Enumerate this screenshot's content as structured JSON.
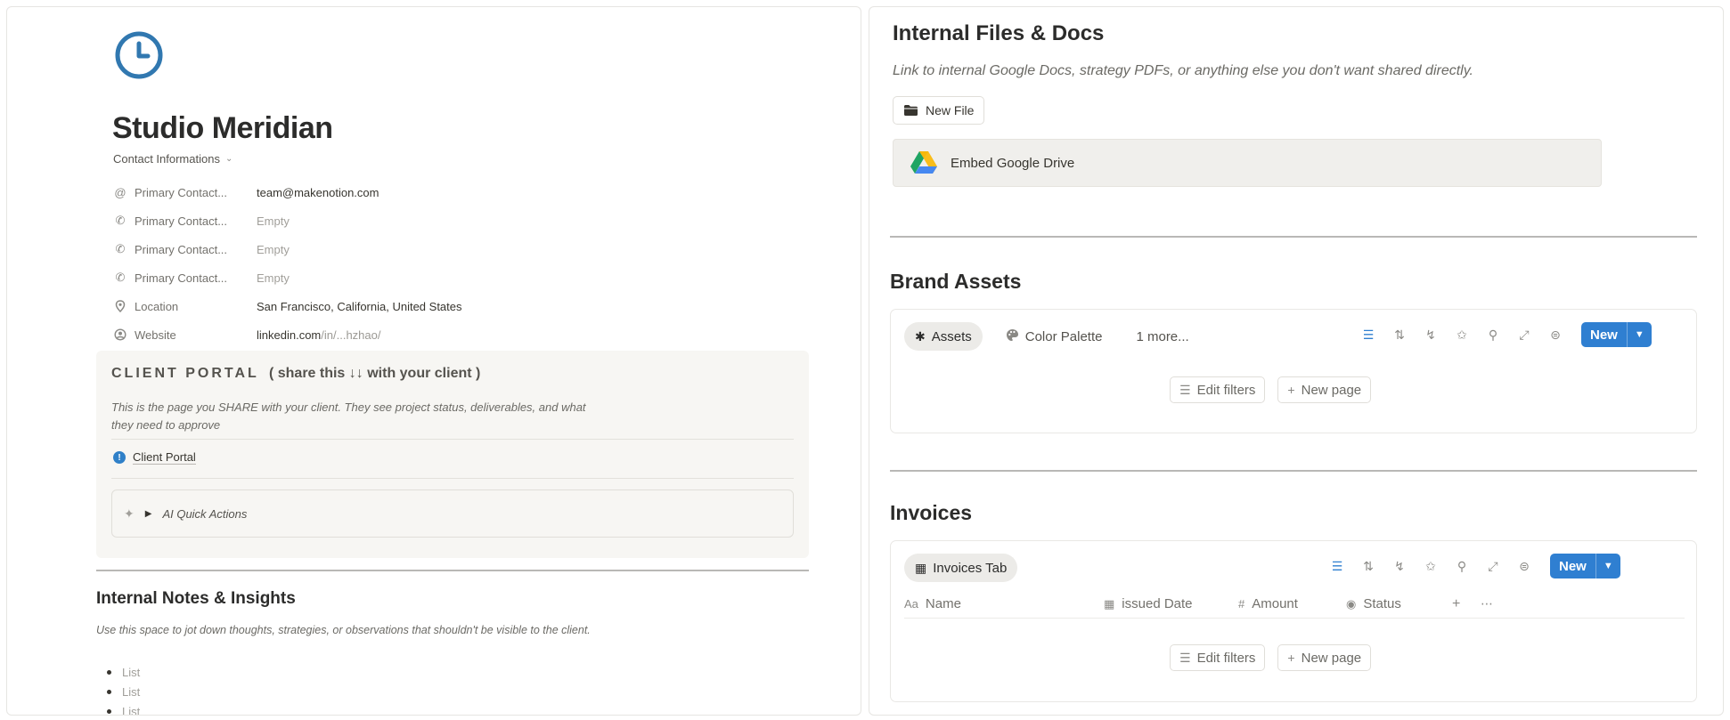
{
  "left": {
    "title": "Studio Meridian",
    "contact_section": {
      "label": "Contact Informations"
    },
    "properties": [
      {
        "icon": "at-icon",
        "name": "Primary Contact...",
        "value": "team@makenotion.com",
        "empty": false
      },
      {
        "icon": "phone-icon",
        "name": "Primary Contact...",
        "value": "Empty",
        "empty": true
      },
      {
        "icon": "phone-icon",
        "name": "Primary Contact...",
        "value": "Empty",
        "empty": true
      },
      {
        "icon": "phone-icon",
        "name": "Primary Contact...",
        "value": "Empty",
        "empty": true
      },
      {
        "icon": "location-pin-icon",
        "name": "Location",
        "value": "San Francisco, California, United States",
        "empty": false
      },
      {
        "icon": "website-icon",
        "name": "Website",
        "value_main": "linkedin.com",
        "value_muted": "/in/...hzhao/"
      }
    ],
    "portal": {
      "title": "CLIENT PORTAL",
      "title_suffix": "( share this ↓↓ with your client )",
      "description": "This is the page you SHARE with your client. They see project status, deliverables, and what they need to approve",
      "link_label": "Client Portal",
      "ai_toggle": "AI Quick Actions"
    },
    "notes": {
      "title": "Internal Notes & Insights",
      "description": "Use this space to jot down thoughts, strategies, or observations that shouldn't be visible to the client.",
      "items": [
        "List",
        "List",
        "List"
      ]
    }
  },
  "right": {
    "files": {
      "title": "Internal Files & Docs",
      "description": "Link to internal Google Docs, strategy PDFs, or anything else you don't want shared directly.",
      "new_file_label": "New File",
      "embed_label": "Embed Google Drive"
    },
    "brand": {
      "title": "Brand Assets",
      "tabs": [
        {
          "label": "Assets",
          "icon": "magic-wand-icon",
          "active": true
        },
        {
          "label": "Color Palette",
          "icon": "palette-icon",
          "active": false
        },
        {
          "label": "1 more...",
          "icon": "",
          "active": false
        }
      ],
      "new_label": "New",
      "edit_filters": "Edit filters",
      "new_page": "New page"
    },
    "invoices": {
      "title": "Invoices",
      "tab_label": "Invoices Tab",
      "columns": [
        {
          "label": "Name",
          "icon": "Aa"
        },
        {
          "label": "issued Date",
          "icon": "calendar-icon"
        },
        {
          "label": "Amount",
          "icon": "#"
        },
        {
          "label": "Status",
          "icon": "status-icon"
        }
      ],
      "new_label": "New",
      "edit_filters": "Edit filters",
      "new_page": "New page"
    }
  },
  "colors": {
    "accent": "#2f7fd1",
    "clock_icon": "#3178b0"
  }
}
